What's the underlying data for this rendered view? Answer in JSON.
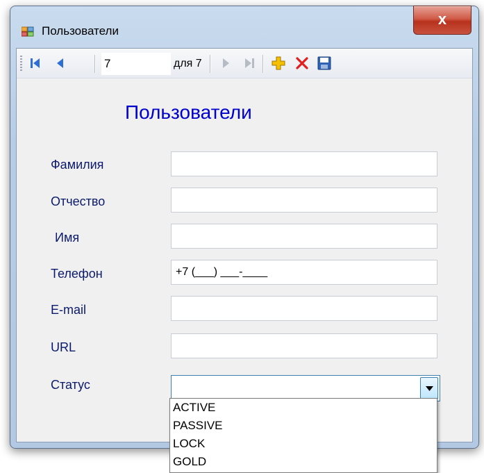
{
  "window": {
    "title": "Пользователи",
    "close_glyph": "x"
  },
  "toolbar": {
    "position_value": "7",
    "count_label": "для 7",
    "buttons": [
      "move-first-icon",
      "move-previous-icon",
      "move-next-icon",
      "move-last-icon",
      "add-icon",
      "delete-icon",
      "save-icon"
    ]
  },
  "form": {
    "title": "Пользователи",
    "fields": {
      "last_name": {
        "label": "Фамилия",
        "value": ""
      },
      "patronymic": {
        "label": "Отчество",
        "value": ""
      },
      "first_name": {
        "label": "Имя",
        "value": ""
      },
      "phone": {
        "label": "Телефон",
        "value": "+7 (___) ___-____"
      },
      "email": {
        "label": "E-mail",
        "value": ""
      },
      "url": {
        "label": "URL",
        "value": ""
      },
      "status": {
        "label": "Статус",
        "value": ""
      }
    },
    "status_options": [
      "ACTIVE",
      "PASSIVE",
      "LOCK",
      "GOLD"
    ]
  },
  "colors": {
    "form_title": "#0000cc",
    "labels": "#0b1a6b",
    "close_button": "#c7523e",
    "delete_icon": "#e02020",
    "add_icon": "#f5c000"
  }
}
